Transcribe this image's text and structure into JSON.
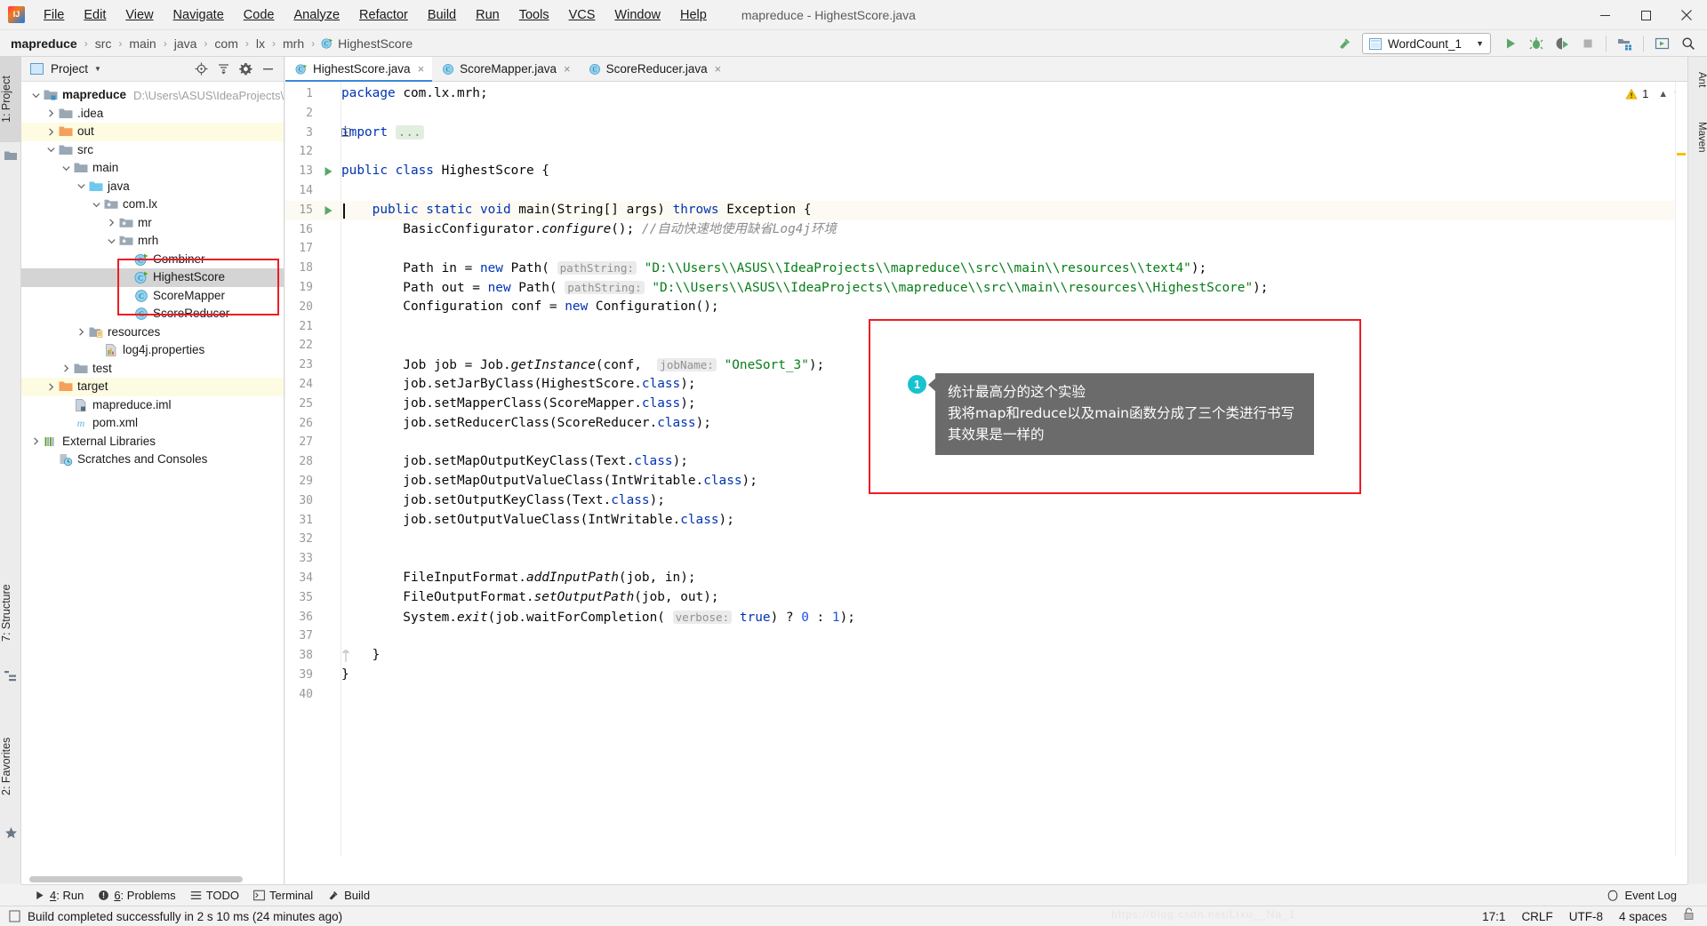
{
  "window": {
    "title": "mapreduce - HighestScore.java",
    "logo_icon": "intellij-idea-logo",
    "minimize_icon": "minimize-icon",
    "maximize_icon": "maximize-icon",
    "close_icon": "close-icon"
  },
  "menu": [
    {
      "label": "File"
    },
    {
      "label": "Edit"
    },
    {
      "label": "View"
    },
    {
      "label": "Navigate"
    },
    {
      "label": "Code"
    },
    {
      "label": "Analyze"
    },
    {
      "label": "Refactor"
    },
    {
      "label": "Build"
    },
    {
      "label": "Run"
    },
    {
      "label": "Tools"
    },
    {
      "label": "VCS"
    },
    {
      "label": "Window"
    },
    {
      "label": "Help"
    }
  ],
  "breadcrumb": {
    "items": [
      "mapreduce",
      "src",
      "main",
      "java",
      "com",
      "lx",
      "mrh",
      "HighestScore"
    ],
    "separator": "›",
    "last_icon": "java-class-icon"
  },
  "toolbar": {
    "build_icon": "build-hammer-icon",
    "run_config": {
      "label": "WordCount_1",
      "icon": "run-config-icon",
      "chevron": "▼"
    },
    "run_icon": "run-play-icon",
    "debug_icon": "debug-bug-icon",
    "run_coverage_icon": "run-with-coverage-icon",
    "stop_icon": "stop-icon",
    "project_structure_icon": "project-structure-icon",
    "select_opened_file_icon": "select-opened-file-icon",
    "search_icon": "search-everywhere-icon"
  },
  "left_strip": {
    "tabs": [
      {
        "label": "1: Project",
        "selected": true
      },
      {
        "label": "7: Structure",
        "selected": false
      },
      {
        "label": "2: Favorites",
        "selected": false
      }
    ],
    "favorites_star_icon": "star-icon"
  },
  "right_strip": {
    "tabs": [
      {
        "label": "Ant"
      },
      {
        "label": "Maven"
      }
    ]
  },
  "project_panel": {
    "title": "Project",
    "title_chevron": "▼",
    "panel_icon": "project-view-icon",
    "actions": [
      {
        "name": "locate-icon",
        "label": "Select Opened File"
      },
      {
        "name": "collapse-all-icon",
        "label": "Collapse All"
      },
      {
        "name": "gear-icon",
        "label": "Settings"
      },
      {
        "name": "hide-icon",
        "label": "Hide"
      }
    ],
    "tree": [
      {
        "indent": 0,
        "twist": "down",
        "icon": "module-folder-icon",
        "label": "mapreduce",
        "bold": true,
        "path": "D:\\Users\\ASUS\\IdeaProjects\\m",
        "state": "normal"
      },
      {
        "indent": 1,
        "twist": "right",
        "icon": "folder-icon",
        "label": ".idea",
        "bold": false,
        "path": "",
        "state": "normal"
      },
      {
        "indent": 1,
        "twist": "right",
        "icon": "folder-orange-icon",
        "label": "out",
        "bold": false,
        "path": "",
        "state": "highlight"
      },
      {
        "indent": 1,
        "twist": "down",
        "icon": "folder-icon",
        "label": "src",
        "bold": false,
        "path": "",
        "state": "normal"
      },
      {
        "indent": 2,
        "twist": "down",
        "icon": "folder-icon",
        "label": "main",
        "bold": false,
        "path": "",
        "state": "normal"
      },
      {
        "indent": 3,
        "twist": "down",
        "icon": "folder-blue-icon",
        "label": "java",
        "bold": false,
        "path": "",
        "state": "normal"
      },
      {
        "indent": 4,
        "twist": "down",
        "icon": "package-icon",
        "label": "com.lx",
        "bold": false,
        "path": "",
        "state": "normal"
      },
      {
        "indent": 5,
        "twist": "right",
        "icon": "package-icon",
        "label": "mr",
        "bold": false,
        "path": "",
        "state": "normal"
      },
      {
        "indent": 5,
        "twist": "down",
        "icon": "package-icon",
        "label": "mrh",
        "bold": false,
        "path": "",
        "state": "normal"
      },
      {
        "indent": 6,
        "twist": "none",
        "icon": "java-class-runnable-icon",
        "label": "Combiner",
        "bold": false,
        "path": "",
        "state": "normal"
      },
      {
        "indent": 6,
        "twist": "none",
        "icon": "java-class-runnable-icon",
        "label": "HighestScore",
        "bold": false,
        "path": "",
        "state": "selected"
      },
      {
        "indent": 6,
        "twist": "none",
        "icon": "java-class-icon",
        "label": "ScoreMapper",
        "bold": false,
        "path": "",
        "state": "normal"
      },
      {
        "indent": 6,
        "twist": "none",
        "icon": "java-class-icon",
        "label": "ScoreReducer",
        "bold": false,
        "path": "",
        "state": "normal"
      },
      {
        "indent": 3,
        "twist": "right",
        "icon": "resources-folder-icon",
        "label": "resources",
        "bold": false,
        "path": "",
        "state": "normal"
      },
      {
        "indent": 4,
        "twist": "none",
        "icon": "properties-file-icon",
        "label": "log4j.properties",
        "bold": false,
        "path": "",
        "state": "normal"
      },
      {
        "indent": 2,
        "twist": "right",
        "icon": "folder-icon",
        "label": "test",
        "bold": false,
        "path": "",
        "state": "normal"
      },
      {
        "indent": 1,
        "twist": "right",
        "icon": "folder-orange-icon",
        "label": "target",
        "bold": false,
        "path": "",
        "state": "highlight"
      },
      {
        "indent": 2,
        "twist": "none",
        "icon": "iml-file-icon",
        "label": "mapreduce.iml",
        "bold": false,
        "path": "",
        "state": "normal"
      },
      {
        "indent": 2,
        "twist": "none",
        "icon": "maven-file-icon",
        "label": "pom.xml",
        "bold": false,
        "path": "",
        "state": "normal"
      },
      {
        "indent": 0,
        "twist": "right",
        "icon": "external-libraries-icon",
        "label": "External Libraries",
        "bold": false,
        "path": "",
        "state": "normal"
      },
      {
        "indent": 1,
        "twist": "none",
        "icon": "scratches-icon",
        "label": "Scratches and Consoles",
        "bold": false,
        "path": "",
        "state": "normal"
      }
    ]
  },
  "editor": {
    "tabs": [
      {
        "label": "HighestScore.java",
        "icon": "java-class-runnable-icon",
        "active": true,
        "close": "×"
      },
      {
        "label": "ScoreMapper.java",
        "icon": "java-class-icon",
        "active": false,
        "close": "×"
      },
      {
        "label": "ScoreReducer.java",
        "icon": "java-class-icon",
        "active": false,
        "close": "×"
      }
    ],
    "inspection": {
      "warning_count": "1",
      "warning_icon": "warning-triangle-icon",
      "up_icon": "chevron-up-icon",
      "down_icon": "chevron-down-icon"
    },
    "caret_line_index": 6,
    "lines": [
      {
        "no": "1",
        "run": false,
        "fold": "",
        "tokens": [
          {
            "t": "package ",
            "c": "k"
          },
          {
            "t": "com.lx.mrh;",
            "c": ""
          }
        ]
      },
      {
        "no": "2",
        "run": false,
        "fold": "",
        "tokens": []
      },
      {
        "no": "3",
        "run": false,
        "fold": "plus",
        "tokens": [
          {
            "t": "import ",
            "c": "k"
          },
          {
            "t": "...",
            "c": "fold-pill"
          }
        ]
      },
      {
        "no": "12",
        "run": false,
        "fold": "",
        "tokens": []
      },
      {
        "no": "13",
        "run": true,
        "fold": "",
        "tokens": [
          {
            "t": "public class ",
            "c": "k"
          },
          {
            "t": "HighestScore {",
            "c": ""
          }
        ]
      },
      {
        "no": "14",
        "run": false,
        "fold": "",
        "tokens": []
      },
      {
        "no": "15",
        "run": true,
        "fold": "minus",
        "tokens": [
          {
            "t": "    ",
            "c": ""
          },
          {
            "t": "public static void ",
            "c": "k"
          },
          {
            "t": "main(String[] args) ",
            "c": ""
          },
          {
            "t": "throws ",
            "c": "k"
          },
          {
            "t": "Exception {",
            "c": ""
          }
        ]
      },
      {
        "no": "16",
        "run": false,
        "fold": "",
        "tokens": [
          {
            "t": "        BasicConfigurator.",
            "c": ""
          },
          {
            "t": "configure",
            "c": "ital"
          },
          {
            "t": "(); ",
            "c": ""
          },
          {
            "t": "//自动快速地使用缺省Log4j环境",
            "c": "cm"
          }
        ]
      },
      {
        "no": "17",
        "run": false,
        "fold": "",
        "tokens": []
      },
      {
        "no": "18",
        "run": false,
        "fold": "",
        "tokens": [
          {
            "t": "        Path in = ",
            "c": ""
          },
          {
            "t": "new ",
            "c": "k"
          },
          {
            "t": "Path( ",
            "c": ""
          },
          {
            "t": "pathString:",
            "c": "hint"
          },
          {
            "t": " ",
            "c": ""
          },
          {
            "t": "\"D:\\\\Users\\\\ASUS\\\\IdeaProjects\\\\mapreduce\\\\src\\\\main\\\\resources\\\\text4\"",
            "c": "s"
          },
          {
            "t": ");",
            "c": ""
          }
        ]
      },
      {
        "no": "19",
        "run": false,
        "fold": "",
        "tokens": [
          {
            "t": "        Path out = ",
            "c": ""
          },
          {
            "t": "new ",
            "c": "k"
          },
          {
            "t": "Path( ",
            "c": ""
          },
          {
            "t": "pathString:",
            "c": "hint"
          },
          {
            "t": " ",
            "c": ""
          },
          {
            "t": "\"D:\\\\Users\\\\ASUS\\\\IdeaProjects\\\\mapreduce\\\\src\\\\main\\\\resources\\\\HighestScore\"",
            "c": "s"
          },
          {
            "t": ");",
            "c": ""
          }
        ]
      },
      {
        "no": "20",
        "run": false,
        "fold": "",
        "tokens": [
          {
            "t": "        Configuration conf = ",
            "c": ""
          },
          {
            "t": "new ",
            "c": "k"
          },
          {
            "t": "Configuration();",
            "c": ""
          }
        ]
      },
      {
        "no": "21",
        "run": false,
        "fold": "",
        "tokens": []
      },
      {
        "no": "22",
        "run": false,
        "fold": "",
        "tokens": []
      },
      {
        "no": "23",
        "run": false,
        "fold": "",
        "tokens": [
          {
            "t": "        Job job = Job.",
            "c": ""
          },
          {
            "t": "getInstance",
            "c": "ital"
          },
          {
            "t": "(conf,  ",
            "c": ""
          },
          {
            "t": "jobName:",
            "c": "hint"
          },
          {
            "t": " ",
            "c": ""
          },
          {
            "t": "\"OneSort_3\"",
            "c": "s"
          },
          {
            "t": ");",
            "c": ""
          }
        ]
      },
      {
        "no": "24",
        "run": false,
        "fold": "",
        "tokens": [
          {
            "t": "        job.setJarByClass(HighestScore.",
            "c": ""
          },
          {
            "t": "class",
            "c": "k"
          },
          {
            "t": ");",
            "c": ""
          }
        ]
      },
      {
        "no": "25",
        "run": false,
        "fold": "",
        "tokens": [
          {
            "t": "        job.setMapperClass(ScoreMapper.",
            "c": ""
          },
          {
            "t": "class",
            "c": "k"
          },
          {
            "t": ");",
            "c": ""
          }
        ]
      },
      {
        "no": "26",
        "run": false,
        "fold": "",
        "tokens": [
          {
            "t": "        job.setReducerClass(ScoreReducer.",
            "c": ""
          },
          {
            "t": "class",
            "c": "k"
          },
          {
            "t": ");",
            "c": ""
          }
        ]
      },
      {
        "no": "27",
        "run": false,
        "fold": "",
        "tokens": []
      },
      {
        "no": "28",
        "run": false,
        "fold": "",
        "tokens": [
          {
            "t": "        job.setMapOutputKeyClass(Text.",
            "c": ""
          },
          {
            "t": "class",
            "c": "k"
          },
          {
            "t": ");",
            "c": ""
          }
        ]
      },
      {
        "no": "29",
        "run": false,
        "fold": "",
        "tokens": [
          {
            "t": "        job.setMapOutputValueClass(IntWritable.",
            "c": ""
          },
          {
            "t": "class",
            "c": "k"
          },
          {
            "t": ");",
            "c": ""
          }
        ]
      },
      {
        "no": "30",
        "run": false,
        "fold": "",
        "tokens": [
          {
            "t": "        job.setOutputKeyClass(Text.",
            "c": ""
          },
          {
            "t": "class",
            "c": "k"
          },
          {
            "t": ");",
            "c": ""
          }
        ]
      },
      {
        "no": "31",
        "run": false,
        "fold": "",
        "tokens": [
          {
            "t": "        job.setOutputValueClass(IntWritable.",
            "c": ""
          },
          {
            "t": "class",
            "c": "k"
          },
          {
            "t": ");",
            "c": ""
          }
        ]
      },
      {
        "no": "32",
        "run": false,
        "fold": "",
        "tokens": []
      },
      {
        "no": "33",
        "run": false,
        "fold": "",
        "tokens": []
      },
      {
        "no": "34",
        "run": false,
        "fold": "",
        "tokens": [
          {
            "t": "        FileInputFormat.",
            "c": ""
          },
          {
            "t": "addInputPath",
            "c": "ital"
          },
          {
            "t": "(job, in);",
            "c": ""
          }
        ]
      },
      {
        "no": "35",
        "run": false,
        "fold": "",
        "tokens": [
          {
            "t": "        FileOutputFormat.",
            "c": ""
          },
          {
            "t": "setOutputPath",
            "c": "ital"
          },
          {
            "t": "(job, out);",
            "c": ""
          }
        ]
      },
      {
        "no": "36",
        "run": false,
        "fold": "",
        "tokens": [
          {
            "t": "        System.",
            "c": ""
          },
          {
            "t": "exit",
            "c": "ital"
          },
          {
            "t": "(job.waitForCompletion( ",
            "c": ""
          },
          {
            "t": "verbose:",
            "c": "hint"
          },
          {
            "t": " ",
            "c": ""
          },
          {
            "t": "true",
            "c": "k"
          },
          {
            "t": ") ? ",
            "c": ""
          },
          {
            "t": "0",
            "c": "num"
          },
          {
            "t": " : ",
            "c": ""
          },
          {
            "t": "1",
            "c": "num"
          },
          {
            "t": ");",
            "c": ""
          }
        ]
      },
      {
        "no": "37",
        "run": false,
        "fold": "",
        "tokens": []
      },
      {
        "no": "38",
        "run": false,
        "fold": "endfold",
        "tokens": [
          {
            "t": "    }",
            "c": ""
          }
        ]
      },
      {
        "no": "39",
        "run": false,
        "fold": "",
        "tokens": [
          {
            "t": "}",
            "c": ""
          }
        ]
      },
      {
        "no": "40",
        "run": false,
        "fold": "",
        "tokens": []
      }
    ]
  },
  "annotation": {
    "badge": "1",
    "lines": [
      "统计最高分的这个实验",
      "我将map和reduce以及main函数分成了三个类进行书写",
      "其效果是一样的"
    ],
    "rect_color": "#ee1c25",
    "badge_color": "#17c3cf",
    "box_color": "#6b6b6b"
  },
  "bottom_tools": [
    {
      "label_prefix": "4",
      "label": ": Run",
      "icon": "run-play-icon"
    },
    {
      "label_prefix": "6",
      "label": ": Problems",
      "icon": "problems-icon"
    },
    {
      "label_prefix": "",
      "label": "TODO",
      "icon": "todo-icon"
    },
    {
      "label_prefix": "",
      "label": "Terminal",
      "icon": "terminal-icon"
    },
    {
      "label_prefix": "",
      "label": "Build",
      "icon": "build-hammer-icon"
    }
  ],
  "event_log": {
    "label": "Event Log",
    "icon": "event-log-icon"
  },
  "status_bar": {
    "message": "Build completed successfully in 2 s 10 ms (24 minutes ago)",
    "message_icon": "build-status-icon",
    "caret_position": "17:1",
    "line_separator": "CRLF",
    "encoding": "UTF-8",
    "indent": "4 spaces",
    "lock_icon": "read-write-lock-icon"
  },
  "watermark": "https://blog.csdn.net/LIxu__Na_1"
}
